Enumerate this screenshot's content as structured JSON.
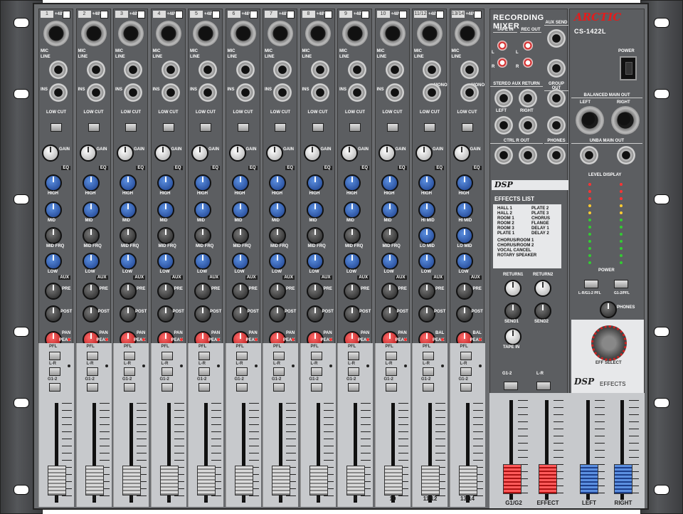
{
  "header": {
    "title": "RECORDING MIXER",
    "brand": "ARCTIC",
    "model": "CS-1422L",
    "power_label": "POWER"
  },
  "channels": [
    {
      "num": "1",
      "label": "1"
    },
    {
      "num": "2",
      "label": "2"
    },
    {
      "num": "3",
      "label": "3"
    },
    {
      "num": "4",
      "label": "4"
    },
    {
      "num": "5",
      "label": "5"
    },
    {
      "num": "6",
      "label": "6"
    },
    {
      "num": "7",
      "label": "7"
    },
    {
      "num": "8",
      "label": "8"
    },
    {
      "num": "9",
      "label": "9"
    },
    {
      "num": "10",
      "label": "10"
    },
    {
      "num": "11/12",
      "label": "11/12"
    },
    {
      "num": "13/14",
      "label": "13/14"
    }
  ],
  "channel_labels": {
    "phantom": "+48V",
    "mic": "MIC",
    "line": "LINE",
    "ins": "INS",
    "lowcut": "LOW CUT",
    "gain": "GAIN",
    "eq": "EQ",
    "high": "HIGH",
    "mid": "MID",
    "midfrq": "MID FRQ",
    "low": "LOW",
    "aux": "AUX",
    "pre": "PRE",
    "post": "POST",
    "pan": "PAN",
    "peak": "PEAK",
    "pfl": "PFL",
    "lr": "L-R",
    "g12": "G1-2",
    "bal": "BAL",
    "himid": "HI MID",
    "lomid": "LO MID",
    "mono": "MONO"
  },
  "master": {
    "tape_in": "TAPE IN",
    "rec_out": "REC OUT",
    "aux_send": "AUX SEND",
    "stereo_aux_return": "STEREO AUX RETURN",
    "group_out": "GROUP OUT",
    "left": "LEFT",
    "right": "RIGHT",
    "ctrl_r_out": "CTRL R OUT",
    "phones": "PHONES",
    "balanced_main_out": "BALANCED MAIN OUT",
    "unba_main_out": "UNBA MAIN OUT",
    "level_display": "LEVEL DISPLAY",
    "power": "POWER",
    "return1": "RETURN1",
    "return2": "RETURN2",
    "send1": "SEND1",
    "send2": "SEND2",
    "tape_in_knob": "TAPE IN",
    "lr_g12_pfl": "L-R/G1-2 PFL",
    "g12_pfl": "G1-2/PFL",
    "phones_knob": "PHONES",
    "eff_select": "EFF SELECT",
    "dsp_effects": "EFFECTS",
    "dsp": "DSP",
    "g1g2": "G1/G2",
    "effect": "EFFECT",
    "left_out": "LEFT",
    "right_out": "RIGHT",
    "g12_btn": "G1-2",
    "lr_btn": "L-R",
    "lr_btn2": "L-R"
  },
  "effects_list": {
    "title": "EFFECTS LIST",
    "col1": [
      "HALL 1",
      "HALL 2",
      "ROOM 1",
      "ROOM 2",
      "ROOM 3",
      "PLATE 1"
    ],
    "col2": [
      "PLATE 2",
      "PLATE 3",
      "CHORUS",
      "FLANGE",
      "DELAY 1",
      "DELAY 2"
    ],
    "extra": [
      "CHORUS/ROOM 1",
      "CHORUS/ROOM 2",
      "VOCAL CANCEL",
      "ROTARY SPEAKER"
    ]
  },
  "colors": {
    "panel": "#6b6d70",
    "accent_red": "#e31c1c",
    "knob_blue": "#2f5fc0",
    "fader_red": "#e33",
    "fader_blue": "#2f5fc0"
  }
}
